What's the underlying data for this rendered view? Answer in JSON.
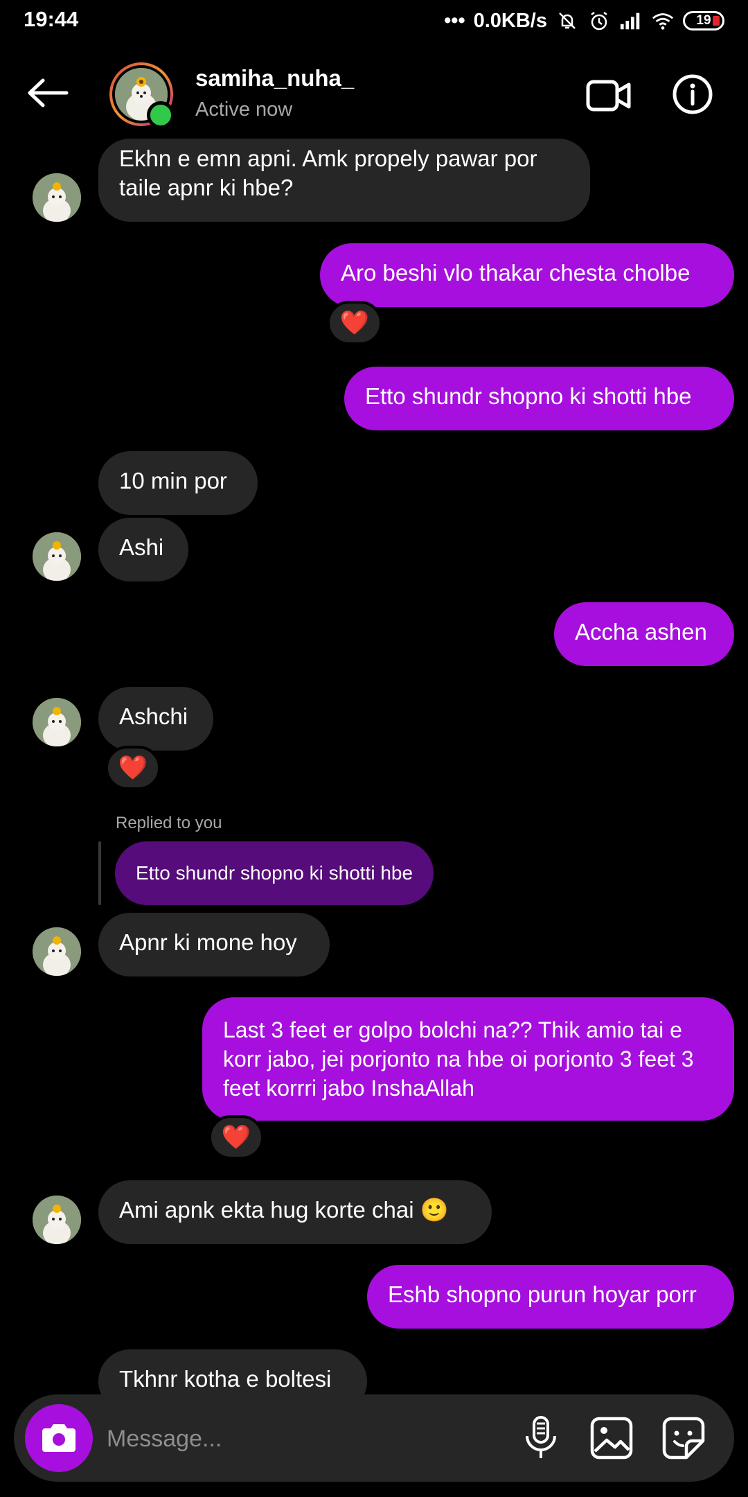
{
  "status_bar": {
    "time": "19:44",
    "speed": "0.0KB/s",
    "battery": "19"
  },
  "header": {
    "username": "samiha_nuha_",
    "status": "Active now"
  },
  "messages": [
    {
      "dir": "in",
      "text": "Ekhn e emn apni. Amk propely pawar por taile apnr ki hbe?"
    },
    {
      "dir": "out",
      "text": "Aro beshi vlo thakar chesta cholbe",
      "reaction": "❤️"
    },
    {
      "dir": "out",
      "text": "Etto shundr shopno ki shotti hbe"
    },
    {
      "dir": "in",
      "text": "10 min por"
    },
    {
      "dir": "in",
      "text": "Ashi"
    },
    {
      "dir": "out",
      "text": "Accha ashen"
    },
    {
      "dir": "in",
      "text": "Ashchi",
      "reaction": "❤️"
    },
    {
      "dir": "in",
      "text": "Apnr ki mone hoy",
      "reply_label": "Replied to you",
      "reply_quote": "Etto shundr shopno ki shotti hbe"
    },
    {
      "dir": "out",
      "text": "Last 3 feet er golpo bolchi na?? Thik amio tai e korr jabo, jei porjonto na hbe oi porjonto 3 feet 3 feet korrri jabo InshaAllah",
      "reaction": "❤️"
    },
    {
      "dir": "in",
      "text": "Ami apnk ekta hug korte chai 🙂"
    },
    {
      "dir": "out",
      "text": "Eshb shopno purun hoyar porr"
    },
    {
      "dir": "in",
      "text": "Tkhnr kotha e boltesi"
    }
  ],
  "composer": {
    "placeholder": "Message..."
  },
  "colors": {
    "outgoing_bubble": "#a60fdd",
    "incoming_bubble": "#262626",
    "reply_bubble": "#560c7a",
    "online": "#32c94b"
  }
}
